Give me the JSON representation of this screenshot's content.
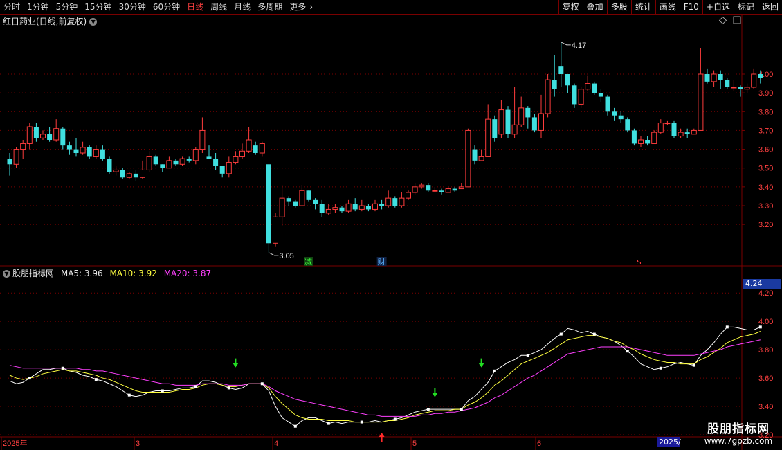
{
  "toolbar": {
    "periods": [
      "分时",
      "1分钟",
      "5分钟",
      "15分钟",
      "30分钟",
      "60分钟",
      "日线",
      "周线",
      "月线",
      "多周期",
      "更多"
    ],
    "active_period": "日线",
    "right_buttons": [
      "复权",
      "叠加",
      "多股",
      "统计",
      "画线",
      "F10",
      "+自选",
      "标记",
      "返回"
    ]
  },
  "stock": {
    "title": "红日药业(日线,前复权)"
  },
  "price_axis": {
    "labels": [
      "4.00",
      "3.90",
      "3.80",
      "3.70",
      "3.60",
      "3.50",
      "3.40",
      "3.30",
      "3.20"
    ]
  },
  "annotations": {
    "high_label": "4.17",
    "low_label": "3.05",
    "flag_jian": "减",
    "flag_cai": "财",
    "flag_s": "$"
  },
  "indicator": {
    "name": "股朋指标网",
    "ma5": "MA5: 3.96",
    "ma10": "MA10: 3.92",
    "ma20": "MA20: 3.87",
    "axis_labels": [
      "4.20",
      "4.00",
      "3.80",
      "3.60",
      "3.40",
      "3.20"
    ],
    "current_value": "4.24"
  },
  "time_axis": {
    "labels": [
      "2025年",
      "3",
      "4",
      "5",
      "6"
    ],
    "current_date": "2025/"
  },
  "watermark": {
    "line1": "股朋指标网",
    "line2": "www.7gpzb.com"
  },
  "colors": {
    "up": "#ff3c3c",
    "down": "#40e0e0",
    "ma5": "#ffffff",
    "ma10": "#ffff40",
    "ma20": "#ff40ff",
    "grid": "#7a0000"
  },
  "chart_data": {
    "type": "candlestick",
    "y_range": [
      3.02,
      4.28
    ],
    "candles": [
      [
        3.55,
        3.52,
        3.58,
        3.46
      ],
      [
        3.52,
        3.6,
        3.61,
        3.5
      ],
      [
        3.6,
        3.63,
        3.65,
        3.55
      ],
      [
        3.63,
        3.72,
        3.74,
        3.6
      ],
      [
        3.72,
        3.66,
        3.74,
        3.64
      ],
      [
        3.66,
        3.68,
        3.7,
        3.65
      ],
      [
        3.68,
        3.65,
        3.72,
        3.64
      ],
      [
        3.65,
        3.71,
        3.76,
        3.64
      ],
      [
        3.71,
        3.62,
        3.72,
        3.6
      ],
      [
        3.62,
        3.6,
        3.64,
        3.57
      ],
      [
        3.6,
        3.58,
        3.66,
        3.56
      ],
      [
        3.58,
        3.61,
        3.64,
        3.57
      ],
      [
        3.61,
        3.56,
        3.62,
        3.55
      ],
      [
        3.56,
        3.6,
        3.62,
        3.55
      ],
      [
        3.6,
        3.55,
        3.62,
        3.54
      ],
      [
        3.55,
        3.48,
        3.56,
        3.47
      ],
      [
        3.48,
        3.49,
        3.51,
        3.46
      ],
      [
        3.49,
        3.45,
        3.5,
        3.44
      ],
      [
        3.45,
        3.47,
        3.48,
        3.44
      ],
      [
        3.47,
        3.45,
        3.49,
        3.43
      ],
      [
        3.45,
        3.49,
        3.54,
        3.44
      ],
      [
        3.49,
        3.56,
        3.59,
        3.48
      ],
      [
        3.56,
        3.52,
        3.57,
        3.51
      ],
      [
        3.52,
        3.5,
        3.52,
        3.48
      ],
      [
        3.5,
        3.54,
        3.56,
        3.5
      ],
      [
        3.54,
        3.52,
        3.55,
        3.51
      ],
      [
        3.52,
        3.55,
        3.56,
        3.51
      ],
      [
        3.55,
        3.54,
        3.56,
        3.53
      ],
      [
        3.54,
        3.6,
        3.61,
        3.52
      ],
      [
        3.6,
        3.7,
        3.77,
        3.58
      ],
      [
        3.56,
        3.55,
        3.62,
        3.55
      ],
      [
        3.55,
        3.51,
        3.58,
        3.49
      ],
      [
        3.51,
        3.47,
        3.51,
        3.45
      ],
      [
        3.47,
        3.53,
        3.56,
        3.45
      ],
      [
        3.53,
        3.56,
        3.59,
        3.52
      ],
      [
        3.56,
        3.59,
        3.63,
        3.55
      ],
      [
        3.59,
        3.65,
        3.72,
        3.58
      ],
      [
        3.62,
        3.58,
        3.64,
        3.57
      ],
      [
        3.58,
        3.63,
        3.64,
        3.56
      ],
      [
        3.52,
        3.1,
        3.52,
        3.05
      ],
      [
        3.1,
        3.24,
        3.26,
        3.08
      ],
      [
        3.24,
        3.34,
        3.41,
        3.19
      ],
      [
        3.34,
        3.32,
        3.35,
        3.3
      ],
      [
        3.32,
        3.3,
        3.33,
        3.29
      ],
      [
        3.3,
        3.38,
        3.41,
        3.3
      ],
      [
        3.38,
        3.33,
        3.38,
        3.32
      ],
      [
        3.33,
        3.31,
        3.34,
        3.28
      ],
      [
        3.31,
        3.26,
        3.33,
        3.24
      ],
      [
        3.26,
        3.28,
        3.31,
        3.25
      ],
      [
        3.28,
        3.29,
        3.31,
        3.26
      ],
      [
        3.29,
        3.27,
        3.3,
        3.26
      ],
      [
        3.27,
        3.31,
        3.33,
        3.26
      ],
      [
        3.31,
        3.28,
        3.34,
        3.27
      ],
      [
        3.28,
        3.3,
        3.33,
        3.27
      ],
      [
        3.3,
        3.28,
        3.31,
        3.27
      ],
      [
        3.28,
        3.31,
        3.33,
        3.27
      ],
      [
        3.31,
        3.3,
        3.33,
        3.28
      ],
      [
        3.3,
        3.34,
        3.38,
        3.29
      ],
      [
        3.34,
        3.3,
        3.35,
        3.29
      ],
      [
        3.3,
        3.34,
        3.37,
        3.29
      ],
      [
        3.34,
        3.37,
        3.38,
        3.33
      ],
      [
        3.37,
        3.4,
        3.42,
        3.36
      ],
      [
        3.4,
        3.41,
        3.42,
        3.39
      ],
      [
        3.41,
        3.38,
        3.42,
        3.37
      ],
      [
        3.38,
        3.38,
        3.4,
        3.37
      ],
      [
        3.38,
        3.37,
        3.39,
        3.36
      ],
      [
        3.37,
        3.39,
        3.4,
        3.37
      ],
      [
        3.39,
        3.38,
        3.4,
        3.37
      ],
      [
        3.39,
        3.4,
        3.42,
        3.39
      ],
      [
        3.4,
        3.7,
        3.71,
        3.4
      ],
      [
        3.6,
        3.54,
        3.62,
        3.52
      ],
      [
        3.54,
        3.56,
        3.6,
        3.54
      ],
      [
        3.56,
        3.76,
        3.84,
        3.56
      ],
      [
        3.76,
        3.66,
        3.78,
        3.64
      ],
      [
        3.68,
        3.81,
        3.86,
        3.66
      ],
      [
        3.81,
        3.68,
        3.83,
        3.66
      ],
      [
        3.68,
        3.73,
        3.93,
        3.66
      ],
      [
        3.73,
        3.82,
        3.88,
        3.72
      ],
      [
        3.82,
        3.77,
        3.83,
        3.71
      ],
      [
        3.77,
        3.7,
        3.79,
        3.69
      ],
      [
        3.7,
        3.79,
        3.89,
        3.66
      ],
      [
        3.79,
        3.97,
        4.0,
        3.77
      ],
      [
        3.97,
        3.92,
        4.1,
        3.88
      ],
      [
        4.04,
        4.0,
        4.17,
        3.93
      ],
      [
        4.0,
        3.94,
        4.0,
        3.9
      ],
      [
        3.94,
        3.84,
        3.95,
        3.82
      ],
      [
        3.84,
        3.92,
        3.93,
        3.82
      ],
      [
        3.92,
        3.95,
        3.99,
        3.91
      ],
      [
        3.95,
        3.9,
        3.96,
        3.89
      ],
      [
        3.9,
        3.88,
        3.92,
        3.85
      ],
      [
        3.88,
        3.8,
        3.89,
        3.78
      ],
      [
        3.8,
        3.78,
        3.82,
        3.75
      ],
      [
        3.78,
        3.76,
        3.8,
        3.74
      ],
      [
        3.76,
        3.7,
        3.77,
        3.69
      ],
      [
        3.7,
        3.63,
        3.71,
        3.62
      ],
      [
        3.63,
        3.65,
        3.67,
        3.61
      ],
      [
        3.65,
        3.63,
        3.67,
        3.62
      ],
      [
        3.63,
        3.69,
        3.7,
        3.63
      ],
      [
        3.69,
        3.74,
        3.76,
        3.68
      ],
      [
        3.74,
        3.74,
        3.75,
        3.73
      ],
      [
        3.74,
        3.67,
        3.75,
        3.66
      ],
      [
        3.67,
        3.69,
        3.71,
        3.66
      ],
      [
        3.69,
        3.68,
        3.71,
        3.66
      ],
      [
        3.68,
        3.7,
        3.71,
        3.68
      ],
      [
        3.7,
        4.0,
        4.14,
        3.7
      ],
      [
        4.0,
        3.96,
        4.03,
        3.95
      ],
      [
        3.96,
        4.0,
        4.02,
        3.93
      ],
      [
        4.0,
        3.97,
        4.02,
        3.92
      ],
      [
        3.97,
        3.93,
        3.98,
        3.92
      ],
      [
        3.93,
        3.93,
        3.97,
        3.91
      ],
      [
        3.93,
        3.92,
        3.94,
        3.88
      ],
      [
        3.92,
        3.93,
        3.95,
        3.9
      ],
      [
        3.93,
        4.0,
        4.03,
        3.92
      ],
      [
        4.0,
        3.98,
        4.02,
        3.95
      ]
    ],
    "ma_series": [
      {
        "name": "MA5",
        "values": [
          3.58,
          3.56,
          3.57,
          3.6,
          3.63,
          3.66,
          3.66,
          3.67,
          3.67,
          3.65,
          3.64,
          3.62,
          3.61,
          3.59,
          3.58,
          3.56,
          3.54,
          3.51,
          3.48,
          3.47,
          3.48,
          3.5,
          3.51,
          3.51,
          3.51,
          3.52,
          3.53,
          3.53,
          3.54,
          3.58,
          3.58,
          3.57,
          3.55,
          3.53,
          3.52,
          3.53,
          3.56,
          3.56,
          3.56,
          3.51,
          3.4,
          3.32,
          3.29,
          3.26,
          3.3,
          3.32,
          3.32,
          3.3,
          3.28,
          3.29,
          3.28,
          3.29,
          3.29,
          3.29,
          3.29,
          3.3,
          3.29,
          3.3,
          3.31,
          3.32,
          3.34,
          3.36,
          3.37,
          3.38,
          3.38,
          3.38,
          3.38,
          3.38,
          3.38,
          3.44,
          3.47,
          3.52,
          3.57,
          3.65,
          3.68,
          3.71,
          3.73,
          3.76,
          3.76,
          3.78,
          3.8,
          3.84,
          3.88,
          3.91,
          3.95,
          3.94,
          3.92,
          3.93,
          3.91,
          3.89,
          3.88,
          3.86,
          3.83,
          3.79,
          3.75,
          3.7,
          3.68,
          3.66,
          3.67,
          3.68,
          3.7,
          3.71,
          3.7,
          3.69,
          3.76,
          3.8,
          3.85,
          3.91,
          3.96,
          3.96,
          3.95,
          3.94,
          3.94,
          3.96
        ]
      },
      {
        "name": "MA10",
        "values": [
          3.62,
          3.6,
          3.59,
          3.6,
          3.61,
          3.63,
          3.64,
          3.65,
          3.66,
          3.65,
          3.65,
          3.64,
          3.63,
          3.62,
          3.6,
          3.59,
          3.57,
          3.55,
          3.53,
          3.51,
          3.5,
          3.5,
          3.5,
          3.5,
          3.5,
          3.51,
          3.52,
          3.52,
          3.53,
          3.55,
          3.56,
          3.56,
          3.55,
          3.54,
          3.54,
          3.55,
          3.56,
          3.56,
          3.56,
          3.53,
          3.47,
          3.42,
          3.38,
          3.34,
          3.32,
          3.31,
          3.31,
          3.31,
          3.3,
          3.3,
          3.3,
          3.3,
          3.29,
          3.29,
          3.29,
          3.29,
          3.29,
          3.3,
          3.3,
          3.31,
          3.32,
          3.34,
          3.35,
          3.36,
          3.37,
          3.37,
          3.37,
          3.38,
          3.38,
          3.41,
          3.43,
          3.46,
          3.5,
          3.55,
          3.58,
          3.62,
          3.66,
          3.7,
          3.72,
          3.74,
          3.76,
          3.78,
          3.81,
          3.84,
          3.87,
          3.88,
          3.89,
          3.9,
          3.9,
          3.89,
          3.88,
          3.86,
          3.85,
          3.82,
          3.8,
          3.77,
          3.75,
          3.73,
          3.72,
          3.71,
          3.71,
          3.7,
          3.7,
          3.7,
          3.73,
          3.75,
          3.78,
          3.81,
          3.85,
          3.87,
          3.89,
          3.9,
          3.91,
          3.93
        ]
      },
      {
        "name": "MA20",
        "values": [
          3.69,
          3.68,
          3.67,
          3.67,
          3.67,
          3.67,
          3.67,
          3.67,
          3.67,
          3.67,
          3.67,
          3.66,
          3.66,
          3.65,
          3.65,
          3.64,
          3.63,
          3.62,
          3.61,
          3.6,
          3.59,
          3.58,
          3.57,
          3.56,
          3.56,
          3.55,
          3.55,
          3.55,
          3.55,
          3.56,
          3.56,
          3.56,
          3.56,
          3.55,
          3.55,
          3.55,
          3.56,
          3.56,
          3.56,
          3.54,
          3.51,
          3.49,
          3.47,
          3.45,
          3.44,
          3.43,
          3.42,
          3.41,
          3.4,
          3.39,
          3.38,
          3.37,
          3.36,
          3.35,
          3.34,
          3.34,
          3.33,
          3.33,
          3.33,
          3.33,
          3.33,
          3.33,
          3.34,
          3.34,
          3.35,
          3.35,
          3.36,
          3.36,
          3.37,
          3.38,
          3.39,
          3.41,
          3.43,
          3.46,
          3.48,
          3.51,
          3.54,
          3.57,
          3.6,
          3.62,
          3.65,
          3.68,
          3.71,
          3.74,
          3.77,
          3.78,
          3.79,
          3.8,
          3.81,
          3.82,
          3.82,
          3.82,
          3.82,
          3.82,
          3.81,
          3.8,
          3.79,
          3.78,
          3.77,
          3.76,
          3.76,
          3.76,
          3.76,
          3.76,
          3.77,
          3.78,
          3.79,
          3.8,
          3.82,
          3.83,
          3.84,
          3.85,
          3.86,
          3.87
        ]
      }
    ],
    "signals": [
      {
        "type": "sell",
        "index": 34,
        "value": 3.69
      },
      {
        "type": "buy",
        "index": 56,
        "value": 3.2
      },
      {
        "type": "sell",
        "index": 64,
        "value": 3.48
      },
      {
        "type": "sell",
        "index": 71,
        "value": 3.69
      }
    ],
    "indicator_y_range": [
      3.2,
      4.24
    ]
  }
}
